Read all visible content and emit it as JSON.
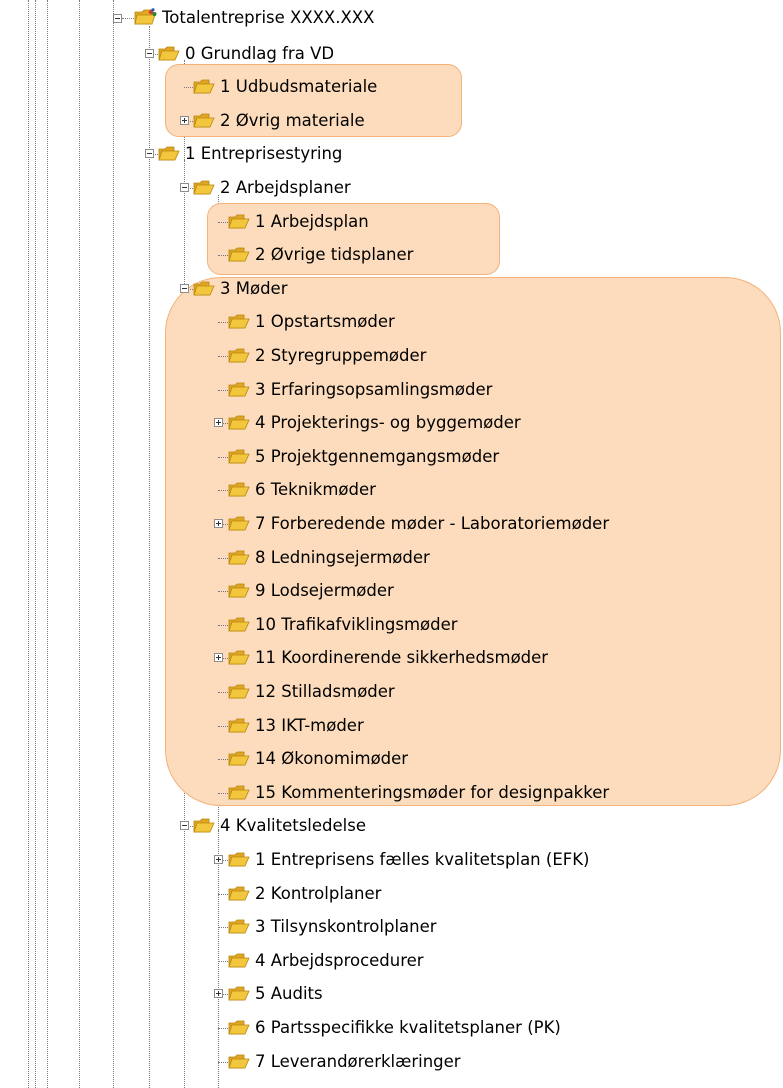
{
  "tree": {
    "root": {
      "label": "Totalentreprise XXXX.XXX",
      "icon": "project-folder-icon",
      "expanded": true
    },
    "nodes": [
      {
        "label": "0 Grundlag fra VD",
        "level": 1,
        "expander": "minus",
        "icon": "folder-open-icon"
      },
      {
        "label": "1 Udbudsmateriale",
        "level": 2,
        "expander": "none",
        "icon": "folder-open-icon"
      },
      {
        "label": "2 Øvrig materiale",
        "level": 2,
        "expander": "plus",
        "icon": "folder-open-icon"
      },
      {
        "label": "1 Entreprisestyring",
        "level": 1,
        "expander": "minus",
        "icon": "folder-open-icon"
      },
      {
        "label": "2 Arbejdsplaner",
        "level": 2,
        "expander": "minus",
        "icon": "folder-open-icon"
      },
      {
        "label": "1 Arbejdsplan",
        "level": 3,
        "expander": "none",
        "icon": "folder-open-icon"
      },
      {
        "label": "2 Øvrige tidsplaner",
        "level": 3,
        "expander": "none",
        "icon": "folder-open-icon"
      },
      {
        "label": "3 Møder",
        "level": 2,
        "expander": "minus",
        "icon": "folder-open-icon"
      },
      {
        "label": "1 Opstartsmøder",
        "level": 3,
        "expander": "none",
        "icon": "folder-open-icon"
      },
      {
        "label": "2 Styregruppemøder",
        "level": 3,
        "expander": "none",
        "icon": "folder-open-icon"
      },
      {
        "label": "3 Erfaringsopsamlingsmøder",
        "level": 3,
        "expander": "none",
        "icon": "folder-open-icon"
      },
      {
        "label": "4 Projekterings- og byggemøder",
        "level": 3,
        "expander": "plus",
        "icon": "folder-open-icon"
      },
      {
        "label": "5 Projektgennemgangsmøder",
        "level": 3,
        "expander": "none",
        "icon": "folder-open-icon"
      },
      {
        "label": "6 Teknikmøder",
        "level": 3,
        "expander": "none",
        "icon": "folder-open-icon"
      },
      {
        "label": "7 Forberedende møder - Laboratoriemøder",
        "level": 3,
        "expander": "plus",
        "icon": "folder-open-icon"
      },
      {
        "label": "8 Ledningsejermøder",
        "level": 3,
        "expander": "none",
        "icon": "folder-open-icon"
      },
      {
        "label": "9 Lodsejermøder",
        "level": 3,
        "expander": "none",
        "icon": "folder-open-icon"
      },
      {
        "label": "10 Trafikafviklingsmøder",
        "level": 3,
        "expander": "none",
        "icon": "folder-open-icon"
      },
      {
        "label": "11 Koordinerende sikkerhedsmøder",
        "level": 3,
        "expander": "plus",
        "icon": "folder-open-icon"
      },
      {
        "label": "12 Stilladsmøder",
        "level": 3,
        "expander": "none",
        "icon": "folder-open-icon"
      },
      {
        "label": "13 IKT-møder",
        "level": 3,
        "expander": "none",
        "icon": "folder-open-icon"
      },
      {
        "label": "14 Økonomimøder",
        "level": 3,
        "expander": "none",
        "icon": "folder-open-icon"
      },
      {
        "label": "15 Kommenteringsmøder for designpakker",
        "level": 3,
        "expander": "none",
        "icon": "folder-open-icon"
      },
      {
        "label": "4 Kvalitetsledelse",
        "level": 2,
        "expander": "minus",
        "icon": "folder-open-icon"
      },
      {
        "label": "1 Entreprisens fælles kvalitetsplan (EFK)",
        "level": 3,
        "expander": "plus",
        "icon": "folder-open-icon"
      },
      {
        "label": "2 Kontrolplaner",
        "level": 3,
        "expander": "none",
        "icon": "folder-open-icon"
      },
      {
        "label": "3 Tilsynskontrolplaner",
        "level": 3,
        "expander": "none",
        "icon": "folder-open-icon"
      },
      {
        "label": "4 Arbejdsprocedurer",
        "level": 3,
        "expander": "none",
        "icon": "folder-open-icon"
      },
      {
        "label": "5 Audits",
        "level": 3,
        "expander": "plus",
        "icon": "folder-open-icon"
      },
      {
        "label": "6 Partsspecifikke kvalitetsplaner (PK)",
        "level": 3,
        "expander": "none",
        "icon": "folder-open-icon"
      },
      {
        "label": "7 Leverandørerklæringer",
        "level": 3,
        "expander": "none",
        "icon": "folder-open-icon"
      }
    ]
  },
  "highlight": {
    "color": "#fcdcbc",
    "border": "#f2b27a"
  },
  "folder_colors": {
    "front": "#f3c73d",
    "back": "#e0a526",
    "edge": "#b8860b"
  }
}
